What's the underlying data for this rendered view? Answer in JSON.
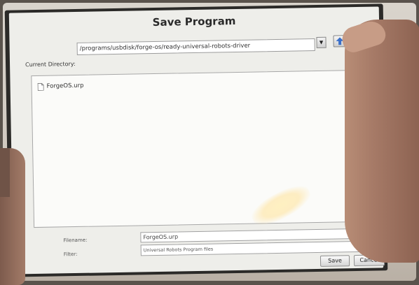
{
  "dialog": {
    "title": "Save Program",
    "current_directory_label": "Current Directory:",
    "current_directory_value": "/programs/usbdisk/forge-os/ready-universal-robots-driver",
    "files": [
      {
        "name": "ForgeOS.urp",
        "icon": "file-icon"
      }
    ],
    "filename_label": "Filename:",
    "filename_value": "ForgeOS.urp",
    "filter_label": "Filter:",
    "filter_value": "Universal Robots Program files",
    "save_label": "Save",
    "cancel_label": "Cancel"
  },
  "icons": {
    "dropdown": "chevron-down-icon",
    "up": "up-arrow-icon"
  },
  "colors": {
    "dialog_bg": "#eeeeea",
    "list_bg": "#fbfbf9",
    "up_arrow": "#3a6fc9"
  }
}
